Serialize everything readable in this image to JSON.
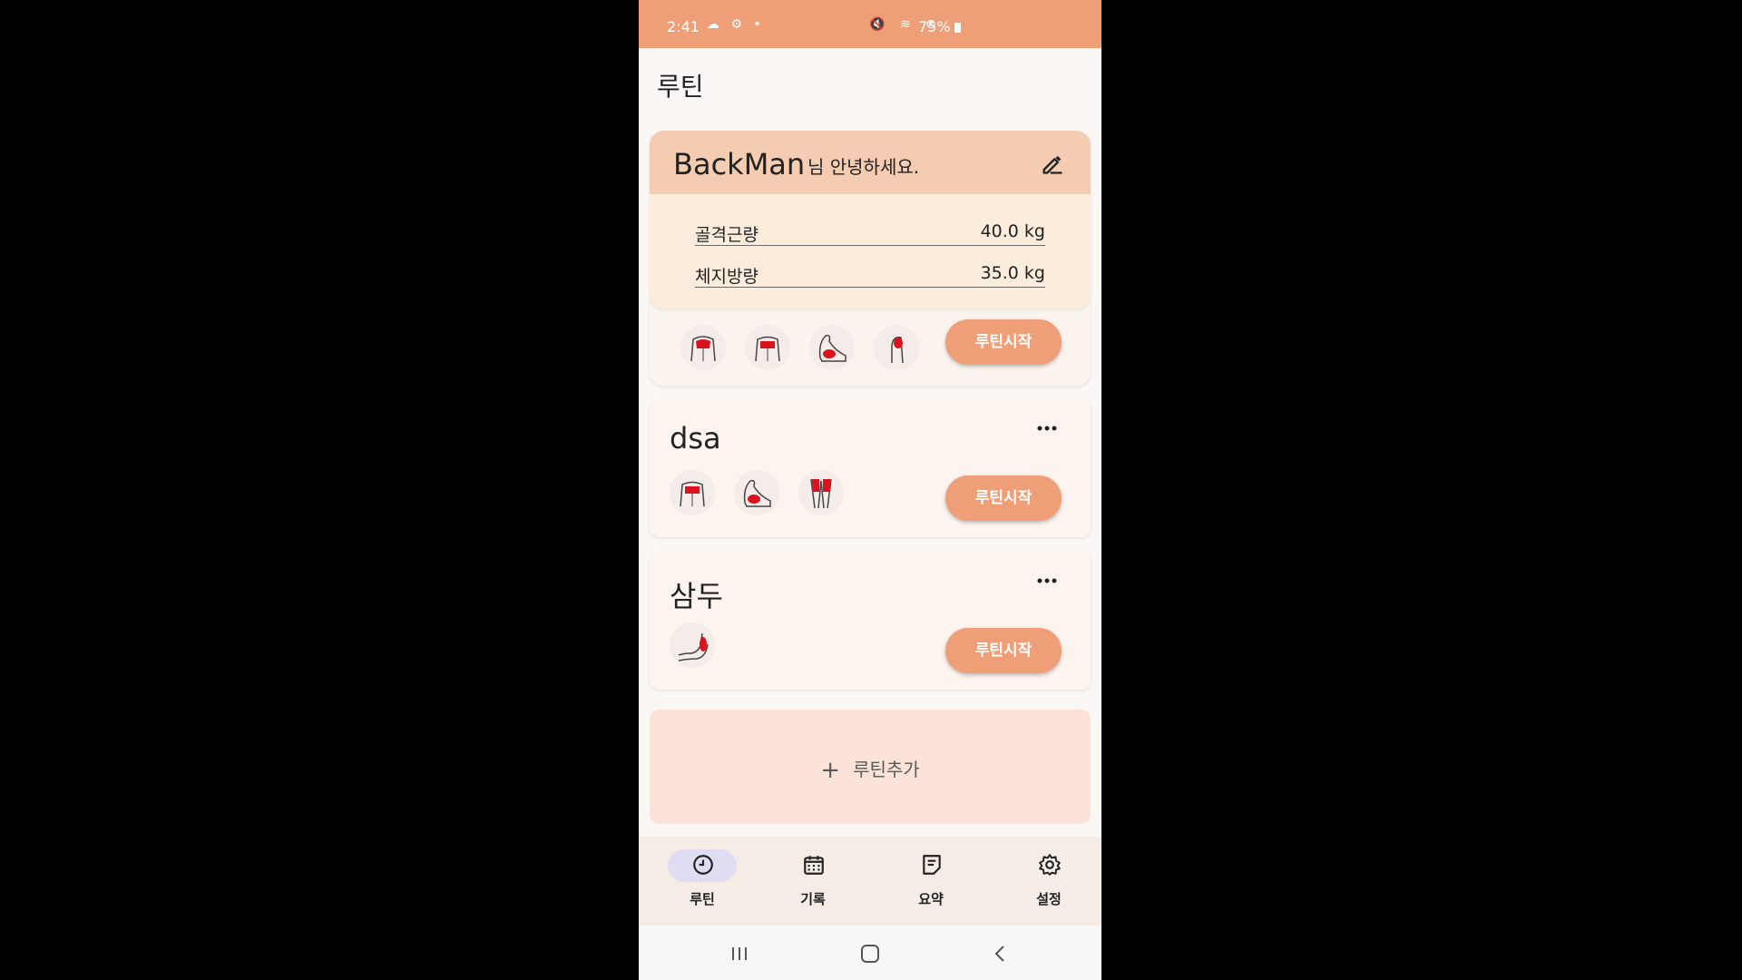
{
  "status_bar": {
    "time": "2:41",
    "battery": "75%"
  },
  "page": {
    "title": "루틴"
  },
  "profile": {
    "name": "BackMan",
    "greeting": "님 안녕하세요.",
    "stats": [
      {
        "label": "골격근량",
        "value": "40.0 kg"
      },
      {
        "label": "체지방량",
        "value": "35.0 kg"
      }
    ],
    "muscles": [
      "chest-front",
      "chest",
      "biceps",
      "shoulder"
    ],
    "start_label": "루틴시작"
  },
  "routines": [
    {
      "title": "dsa",
      "muscles": [
        "chest",
        "biceps",
        "legs"
      ],
      "start_label": "루틴시작"
    },
    {
      "title": "삼두",
      "muscles": [
        "triceps"
      ],
      "start_label": "루틴시작"
    }
  ],
  "add_routine": {
    "label": "루틴추가"
  },
  "nav": {
    "items": [
      {
        "label": "루틴",
        "icon": "routine-icon",
        "active": true
      },
      {
        "label": "기록",
        "icon": "calendar-icon",
        "active": false
      },
      {
        "label": "요약",
        "icon": "summary-icon",
        "active": false
      },
      {
        "label": "설정",
        "icon": "settings-icon",
        "active": false
      }
    ]
  },
  "colors": {
    "accent": "#ee9f78",
    "profile_header": "#f4ccb1",
    "muscle_highlight": "#d9141e",
    "nav_active_pill": "#e0dcf2"
  }
}
